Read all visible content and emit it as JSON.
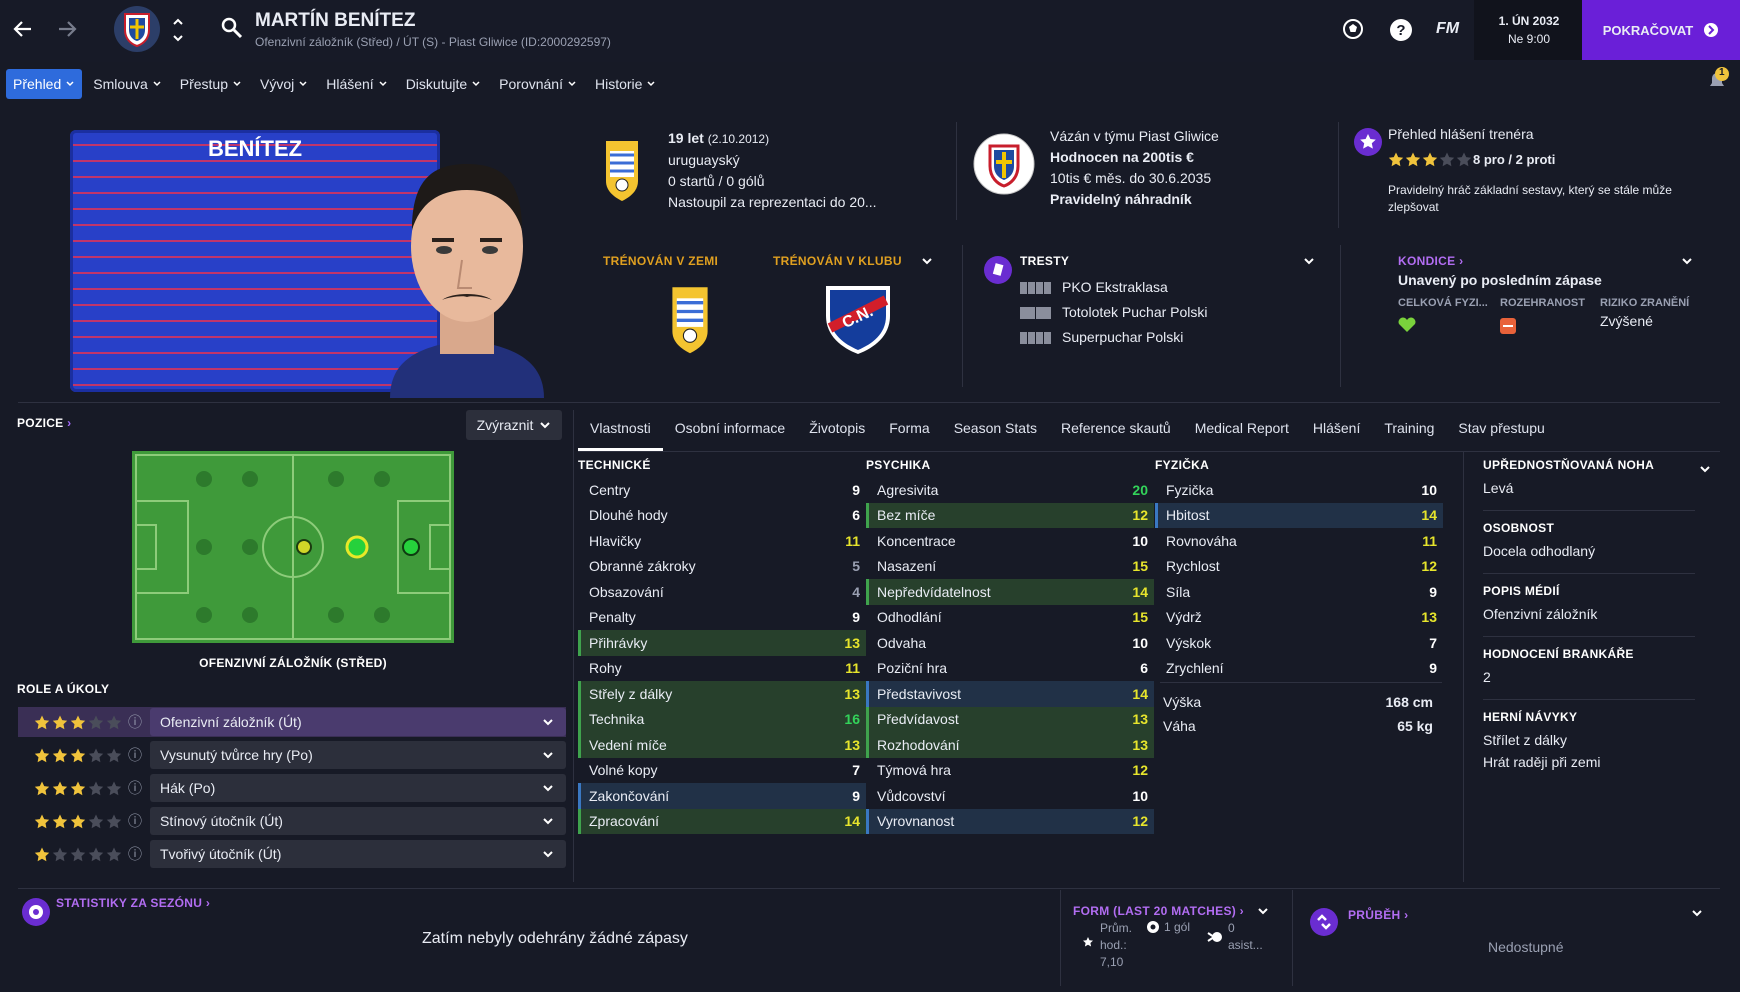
{
  "header": {
    "name": "MARTÍN BENÍTEZ",
    "subtitle": "Ofenzivní záložník (Střed) / ÚT (S) - Piast Gliwice (ID:2000292597)",
    "date": "1. ÚN 2032",
    "day": "Ne 9:00",
    "continue": "POKRAČOVAT",
    "fm": "FM",
    "notif_count": "1"
  },
  "subnav": [
    "Přehled",
    "Smlouva",
    "Přestup",
    "Vývoj",
    "Hlášení",
    "Diskutujte",
    "Porovnání",
    "Historie"
  ],
  "kit": {
    "name": "BENÍTEZ"
  },
  "bio": {
    "age": "19 let",
    "dob": "(2.10.2012)",
    "nationality": "uruguayský",
    "apps": "0 startů / 0 gólů",
    "intl": "Nastoupil za reprezentaci do 20..."
  },
  "contract": {
    "line1": "Vázán v týmu Piast Gliwice",
    "line2": "Hodnocen na 200tis €",
    "line3": "10tis € měs. do 30.6.2035",
    "line4": "Pravidelný náhradník"
  },
  "report": {
    "title": "Přehled hlášení trenéra",
    "pros": "8 pro / 2 proti",
    "stars": 3,
    "text": "Pravidelný hráč základní sestavy, který se stále může zlepšovat"
  },
  "trained": {
    "country": "TRÉNOVÁN V ZEMI",
    "club": "TRÉNOVÁN V KLUBU"
  },
  "bans": {
    "title": "TRESTY",
    "items": [
      "PKO Ekstraklasa",
      "Totolotek Puchar Polski",
      "Superpuchar Polski"
    ]
  },
  "condition": {
    "title": "KONDICE",
    "status": "Unavený po posledním zápase",
    "col1": "CELKOVÁ FYZI...",
    "col2": "ROZEHRANOST",
    "col3": "RIZIKO ZRANĚNÍ",
    "risk": "Zvýšené"
  },
  "position": {
    "title": "POZICE",
    "highlight": "Zvýraznit",
    "label": "OFENZIVNÍ ZÁLOŽNÍK (STŘED)",
    "roles_title": "ROLE A ÚKOLY"
  },
  "roles": [
    {
      "name": "Ofenzivní záložník (Út)",
      "stars": 3
    },
    {
      "name": "Vysunutý tvůrce hry (Po)",
      "stars": 3
    },
    {
      "name": "Hák (Po)",
      "stars": 3
    },
    {
      "name": "Stínový útočník (Út)",
      "stars": 3
    },
    {
      "name": "Tvořivý útočník (Út)",
      "stars": 1
    }
  ],
  "tabs": [
    "Vlastnosti",
    "Osobní informace",
    "Životopis",
    "Forma",
    "Season Stats",
    "Reference skautů",
    "Medical Report",
    "Hlášení",
    "Training",
    "Stav přestupu"
  ],
  "attributes": {
    "technical_title": "TECHNICKÉ",
    "technical": [
      [
        "Centry",
        "9",
        ""
      ],
      [
        "Dlouhé hody",
        "6",
        ""
      ],
      [
        "Hlavičky",
        "11",
        ""
      ],
      [
        "Obranné zákroky",
        "5",
        ""
      ],
      [
        "Obsazování",
        "4",
        ""
      ],
      [
        "Penalty",
        "9",
        ""
      ],
      [
        "Přihrávky",
        "13",
        "g"
      ],
      [
        "Rohy",
        "11",
        ""
      ],
      [
        "Střely z dálky",
        "13",
        "g"
      ],
      [
        "Technika",
        "16",
        "g"
      ],
      [
        "Vedení míče",
        "13",
        "g"
      ],
      [
        "Volné kopy",
        "7",
        ""
      ],
      [
        "Zakončování",
        "9",
        "b"
      ],
      [
        "Zpracování",
        "14",
        "g"
      ]
    ],
    "mental_title": "PSYCHIKA",
    "mental": [
      [
        "Agresivita",
        "20",
        ""
      ],
      [
        "Bez míče",
        "12",
        "g"
      ],
      [
        "Koncentrace",
        "10",
        ""
      ],
      [
        "Nasazení",
        "15",
        ""
      ],
      [
        "Nepředvídatelnost",
        "14",
        "g"
      ],
      [
        "Odhodlání",
        "15",
        ""
      ],
      [
        "Odvaha",
        "10",
        ""
      ],
      [
        "Poziční hra",
        "6",
        ""
      ],
      [
        "Představivost",
        "14",
        "b"
      ],
      [
        "Předvídavost",
        "13",
        "g"
      ],
      [
        "Rozhodování",
        "13",
        "g"
      ],
      [
        "Týmová hra",
        "12",
        ""
      ],
      [
        "Vůdcovství",
        "10",
        ""
      ],
      [
        "Vyrovnanost",
        "12",
        "b"
      ]
    ],
    "physical_title": "FYZIČKA",
    "physical": [
      [
        "Fyzička",
        "10",
        ""
      ],
      [
        "Hbitost",
        "14",
        "b"
      ],
      [
        "Rovnováha",
        "11",
        ""
      ],
      [
        "Rychlost",
        "12",
        ""
      ],
      [
        "Síla",
        "9",
        ""
      ],
      [
        "Výdrž",
        "13",
        ""
      ],
      [
        "Výskok",
        "7",
        ""
      ],
      [
        "Zrychlení",
        "9",
        ""
      ]
    ],
    "height_label": "Výška",
    "height": "168 cm",
    "weight_label": "Váha",
    "weight": "65 kg"
  },
  "info": [
    {
      "label": "UPŘEDNOSTŇOVANÁ NOHA",
      "value": "Levá"
    },
    {
      "label": "OSOBNOST",
      "value": "Docela odhodlaný"
    },
    {
      "label": "POPIS MÉDIÍ",
      "value": "Ofenzivní záložník"
    },
    {
      "label": "HODNOCENÍ BRANKÁŘE",
      "value": "2"
    },
    {
      "label": "HERNÍ NÁVYKY",
      "value": "Střílet z dálky",
      "value2": "Hrát raději při zemi"
    }
  ],
  "bottom": {
    "stats_title": "STATISTIKY ZA SEZÓNU",
    "stats_empty": "Zatím nebyly odehrány žádné zápasy",
    "form_title": "FORM (LAST 20 MATCHES)",
    "avg_label1": "Prům.",
    "avg_label2": "hod.:",
    "avg": "7,10",
    "goals": "1 gól",
    "assists1": "0",
    "assists2": "asist...",
    "progress_title": "PRŮBĚH",
    "progress_value": "Nedostupné"
  }
}
